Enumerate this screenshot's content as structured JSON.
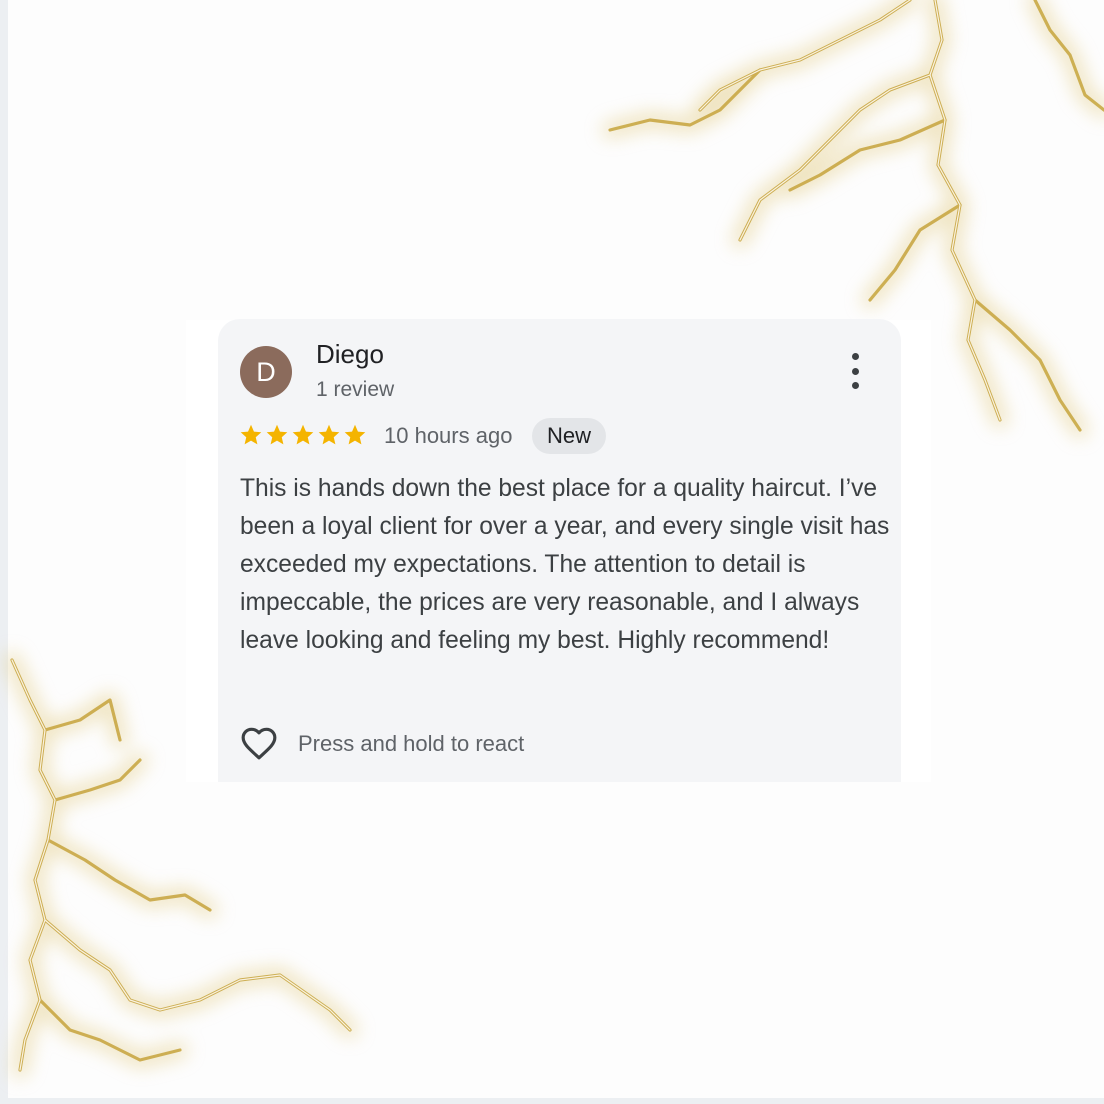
{
  "review": {
    "avatar_initial": "D",
    "avatar_color": "#8b6b5c",
    "reviewer_name": "Diego",
    "review_count": "1 review",
    "rating": 5,
    "rating_max": 5,
    "star_color": "#f4b400",
    "timestamp": "10 hours ago",
    "badge": "New",
    "text": "This is hands down the best place for a quality haircut. I’ve been a loyal client for over a year, and every single visit has exceeded my expectations. The attention to detail is impeccable, the prices are very reasonable, and I always leave looking and feeling my best. Highly recommend!",
    "react_label": "Press and hold to react",
    "react_icon": "heart-outline-icon",
    "menu_icon": "more-vert-icon"
  },
  "decoration": {
    "lightning_color": "#d4b65a"
  }
}
